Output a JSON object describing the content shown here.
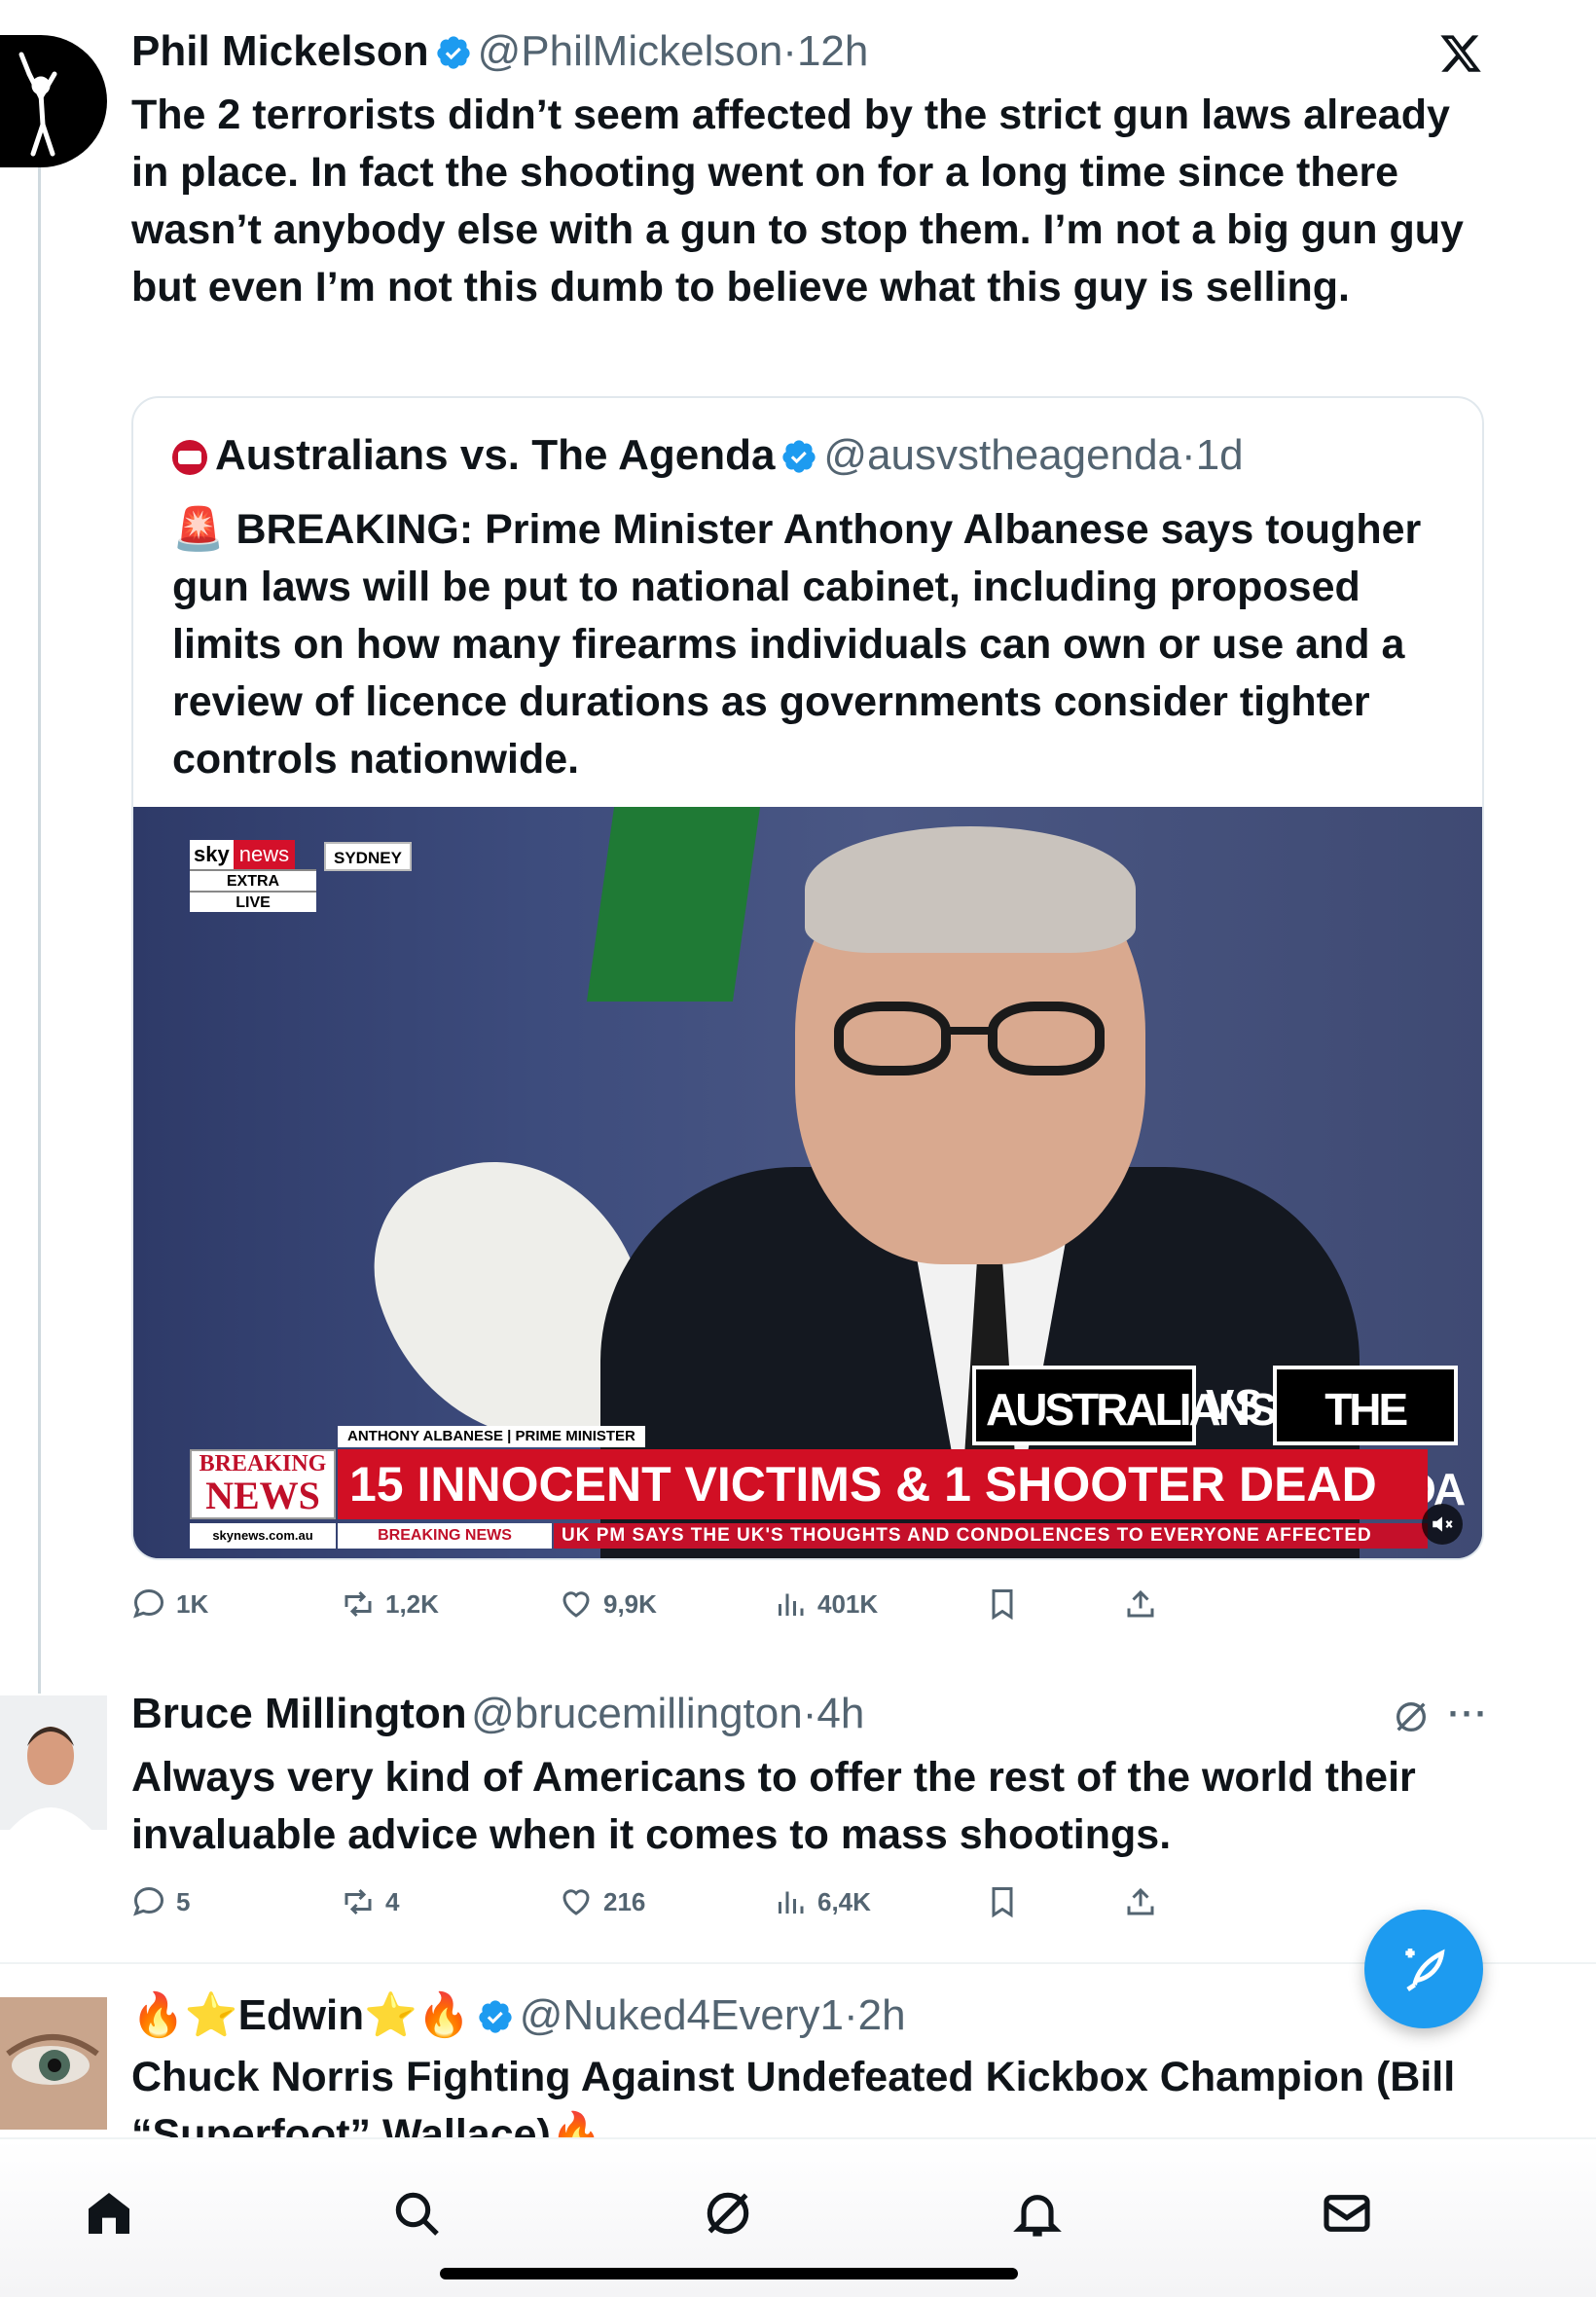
{
  "colors": {
    "accent": "#1d9bf0",
    "text": "#0f1419",
    "secondary": "#536471",
    "breaking_red": "#d10f24"
  },
  "tweets": [
    {
      "name": "Phil Mickelson",
      "handle": "@PhilMickelson",
      "dot": "·",
      "time": "12h",
      "verified": true,
      "text": "The 2 terrorists didn’t seem affected by the strict gun laws already in place. In fact the shooting went on for a long time since there wasn’t anybody else with a gun to stop them. I’m not a big gun guy but even I’m not this dumb to believe what this guy is selling.",
      "action_icon": "x-logo-icon",
      "quote": {
        "name": "Australians vs. The Agenda",
        "handle": "@ausvstheagenda",
        "dot": "·",
        "time": "1d",
        "text": "🚨 BREAKING: Prime Minister Anthony Albanese says tougher gun laws will be put to national cabinet, including proposed limits on how many firearms individuals can own or use and a review of licence durations as governments consider tighter controls nationwide.",
        "video": {
          "sky": "sky",
          "news": "news",
          "sydney": "SYDNEY",
          "extra": "EXTRA",
          "live": "LIVE",
          "brand_left": "AUSTRALIANS",
          "brand_vs": "VS",
          "brand_right": "THE AGENDA",
          "name_strap": "ANTHONY ALBANESE | PRIME MINISTER",
          "breaking_1": "BREAKING",
          "breaking_2": "NEWS",
          "headline": "15 INNOCENT VICTIMS & 1 SHOOTER DEAD",
          "site": "skynews.com.au",
          "ticker_label": "BREAKING NEWS",
          "ticker": "UK PM SAYS THE UK'S THOUGHTS AND CONDOLENCES TO EVERYONE AFFECTED",
          "mute_icon": "muted-speaker-icon"
        }
      },
      "stats": {
        "replies": "1K",
        "reposts": "1,2K",
        "likes": "9,9K",
        "views": "401K"
      }
    },
    {
      "name": "Bruce Millington",
      "handle": "@brucemillington",
      "dot": "·",
      "time": "4h",
      "text": "Always very kind of Americans to offer the rest of the world their invaluable advice when it comes to mass shootings.",
      "more": "···",
      "stats": {
        "replies": "5",
        "reposts": "4",
        "likes": "216",
        "views": "6,4K"
      }
    },
    {
      "name_prefix": "🔥⭐",
      "name": "Edwin",
      "name_suffix": "⭐🔥",
      "handle": "@Nuked4Every1",
      "dot": "·",
      "time": "2h",
      "verified": true,
      "text": "Chuck Norris Fighting Against Undefeated Kickbox Champion (Bill “Superfoot” Wallace)🔥"
    }
  ],
  "nav": [
    "home-icon",
    "search-icon",
    "grok-icon",
    "notifications-icon",
    "messages-icon"
  ],
  "fab_icon": "compose-icon"
}
